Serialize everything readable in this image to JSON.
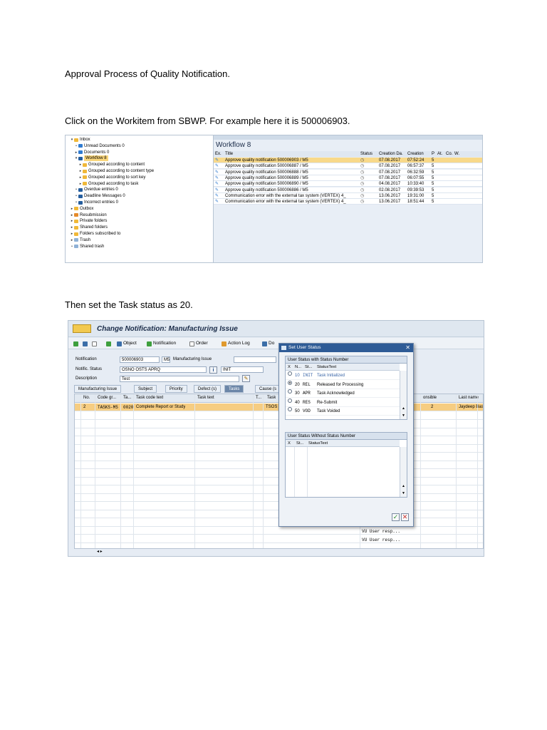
{
  "doc": {
    "para1": "Approval Process of Quality Notification.",
    "para2": "Click on the Workitem from SBWP. For example here it is 500006903.",
    "para3": "Then set the Task status as 20."
  },
  "sbwp": {
    "tree": [
      {
        "label": "Inbox",
        "icon": "folder-icon",
        "arrow": "▾"
      },
      {
        "label": "Unread Documents 0",
        "icon": "document-icon",
        "arrow": "•"
      },
      {
        "label": "Documents 0",
        "icon": "document-icon",
        "arrow": "▸"
      },
      {
        "label": "Workflow 8",
        "icon": "workflow-icon",
        "arrow": "▾"
      },
      {
        "label": "Grouped according to content",
        "icon": "folder-icon",
        "arrow": "▸"
      },
      {
        "label": "Grouped according to content type",
        "icon": "folder-icon",
        "arrow": "▸"
      },
      {
        "label": "Grouped according to sort key",
        "icon": "folder-icon",
        "arrow": "▸"
      },
      {
        "label": "Grouped according to task",
        "icon": "folder-icon",
        "arrow": "▸"
      },
      {
        "label": "Overdue entries 0",
        "icon": "workflow-icon",
        "arrow": "•"
      },
      {
        "label": "Deadline Messages 0",
        "icon": "workflow-icon",
        "arrow": "•"
      },
      {
        "label": "Incorrect entries 0",
        "icon": "workflow-icon",
        "arrow": "•"
      },
      {
        "label": "Outbox",
        "icon": "folder-icon",
        "arrow": "▸"
      },
      {
        "label": "Resubmission",
        "icon": "resubmission-icon",
        "arrow": "▸"
      },
      {
        "label": "Private folders",
        "icon": "folder-icon",
        "arrow": "▸"
      },
      {
        "label": "Shared folders",
        "icon": "folder-icon",
        "arrow": "▸"
      },
      {
        "label": "Folders subscribed to",
        "icon": "folder-icon",
        "arrow": "▸"
      },
      {
        "label": "Trash",
        "icon": "trash-icon",
        "arrow": "▸"
      },
      {
        "label": "Shared trash",
        "icon": "trash-icon",
        "arrow": "•"
      }
    ],
    "workflow_title": "Workflow 8",
    "columns": {
      "ex": "Ex.",
      "title": "Title",
      "status": "Status",
      "date": "Creation Da.",
      "time": "Creation",
      "p": "P",
      "at": "At.",
      "co": "Co.",
      "w": "W."
    },
    "rows": [
      {
        "title": "Approve quality notification 500006903 / M5",
        "date": "07.08.2017",
        "time": "07:52:24",
        "p": "5"
      },
      {
        "title": "Approve quality notification 500006887 / M5",
        "date": "07.08.2017",
        "time": "06:57:37",
        "p": "5"
      },
      {
        "title": "Approve quality notification 500006888 / M5",
        "date": "07.08.2017",
        "time": "06:32:59",
        "p": "5"
      },
      {
        "title": "Approve quality notification 500006889 / M5",
        "date": "07.08.2017",
        "time": "06:07:55",
        "p": "5"
      },
      {
        "title": "Approve quality notification 500006890 / M5",
        "date": "04.08.2017",
        "time": "10:33:40",
        "p": "5"
      },
      {
        "title": "Approve quality notification 500006886 / M5",
        "date": "02.08.2017",
        "time": "09:39:53",
        "p": "5"
      },
      {
        "title": "Communication error with the external tax system (VERTEX) 4_",
        "date": "13.06.2017",
        "time": "19:31:00",
        "p": "5"
      },
      {
        "title": "Communication error with the external tax system (VERTEX) 4_",
        "date": "13.06.2017",
        "time": "18:51:44",
        "p": "5"
      }
    ]
  },
  "notif": {
    "title": "Change Notification: Manufacturing Issue",
    "toolbar": {
      "object": "Object",
      "notification": "Notification",
      "order": "Order",
      "action_log": "Action Log",
      "do": "Do"
    },
    "labels": {
      "notification": "Notification",
      "status": "Notific. Status",
      "description": "Description"
    },
    "values": {
      "number": "500006903",
      "type": "M5",
      "type_text": "Manufacturing Issue",
      "status": "OSNO OSTS APRQ",
      "init": "INIT",
      "description": "Test"
    },
    "tabs": [
      "Manufacturing Issue",
      "Subject",
      "Priority",
      "Defect (s)",
      "Tasks",
      "Cause (s"
    ],
    "grid_headers": {
      "no": "No.",
      "code_group": "Code gr...",
      "ta": "Ta...",
      "task_code_text": "Task code text",
      "task_text": "Task text",
      "t": "T...",
      "task": "Task",
      "responsible": "onsible",
      "last_name": "Last name"
    },
    "row": {
      "no": "2",
      "code_group": "TASKS-M5",
      "ta": "0020",
      "task_code_text": "Complete Report or Study",
      "task": "TSOS",
      "responsible": "2",
      "last_name": "Jaydeep Basu"
    },
    "vu_text": "VU User resp..."
  },
  "dialog": {
    "title": "Set User Status",
    "group1": "User Status with Status Number",
    "group2": "User Status Without Status Number",
    "head1": {
      "x": "X",
      "n": "N...",
      "st": "St...",
      "text": "StatusText"
    },
    "head2": {
      "x": "X",
      "st": "St...",
      "text": "StatusText"
    },
    "statuses": [
      {
        "num": "10",
        "code": "INIT",
        "text": "Task Initialized",
        "selected": false,
        "highlight": true
      },
      {
        "num": "20",
        "code": "REL",
        "text": "Released for Processing",
        "selected": true,
        "highlight": false
      },
      {
        "num": "30",
        "code": "APR",
        "text": "Task Acknowledged",
        "selected": false,
        "highlight": false
      },
      {
        "num": "40",
        "code": "RES",
        "text": "Re-Submit",
        "selected": false,
        "highlight": false
      },
      {
        "num": "50",
        "code": "VOD",
        "text": "Task Voided",
        "selected": false,
        "highlight": false
      }
    ]
  }
}
